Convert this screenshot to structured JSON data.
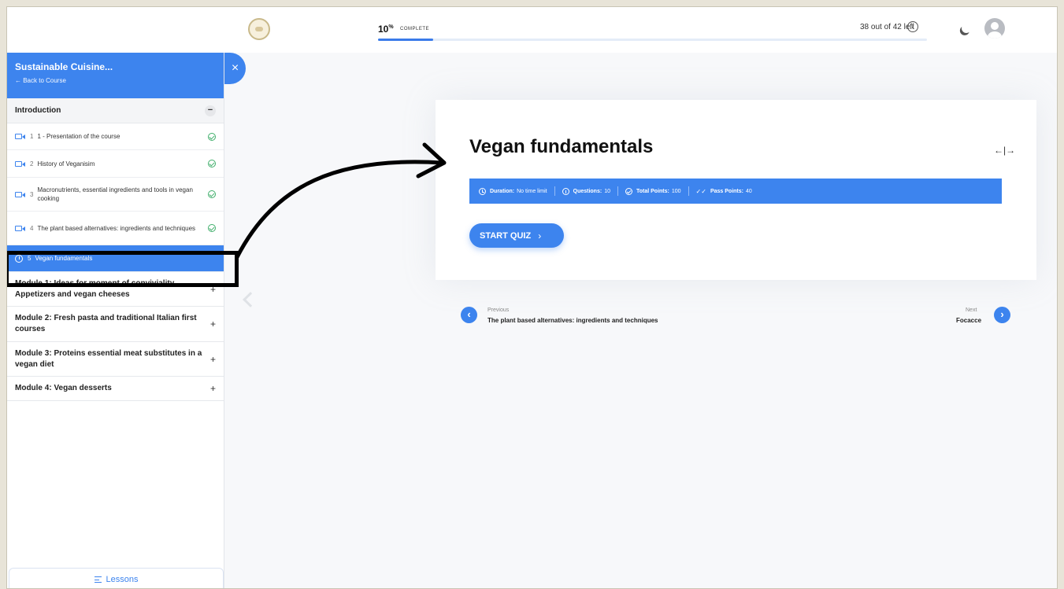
{
  "topbar": {
    "progress_percent": "10",
    "progress_symbol": "%",
    "progress_label": "COMPLETE",
    "progress_fraction": 0.1,
    "lessons_left": "38 out of 42 left",
    "info_icon": "info-icon",
    "theme_icon": "moon-icon",
    "avatar_icon": "user-avatar"
  },
  "sidebar": {
    "course_title": "Sustainable Cuisine...",
    "back_link": "← Back to Course",
    "intro_section": {
      "title": "Introduction",
      "toggle": "−",
      "lessons": [
        {
          "number": "1",
          "title": "1 - Presentation of the course",
          "icon": "video-icon",
          "status": "completed"
        },
        {
          "number": "2",
          "title": "History of Veganisim",
          "icon": "video-icon",
          "status": "completed"
        },
        {
          "number": "3",
          "title": "Macronutrients, essential ingredients and tools in vegan cooking",
          "icon": "video-icon",
          "status": "completed"
        },
        {
          "number": "4",
          "title": "The plant based alternatives: ingredients and techniques",
          "icon": "video-icon",
          "status": "completed"
        },
        {
          "number": "5",
          "title": "Vegan fundamentals",
          "icon": "timer-icon",
          "status": "active"
        }
      ]
    },
    "modules": [
      {
        "title": "Module 1: Ideas for moment of conviviality. Appetizers and vegan cheeses",
        "toggle": "+"
      },
      {
        "title": "Module 2: Fresh pasta and traditional Italian first courses",
        "toggle": "+"
      },
      {
        "title": "Module 3: Proteins essential meat substitutes in a vegan diet",
        "toggle": "+"
      },
      {
        "title": "Module 4: Vegan desserts",
        "toggle": "+"
      }
    ],
    "close_label": "×",
    "lessons_button": "Lessons"
  },
  "quiz": {
    "title": "Vegan fundamentals",
    "expand_icon": "←|→",
    "duration_label": "Duration:",
    "duration_value": "No time limit",
    "questions_label": "Questions:",
    "questions_value": "10",
    "total_points_label": "Total Points:",
    "total_points_value": "100",
    "pass_points_label": "Pass Points:",
    "pass_points_value": "40",
    "start_button": "START QUIZ",
    "start_chevron": "›"
  },
  "navigation": {
    "previous_label": "Previous",
    "previous_title": "The plant based alternatives: ingredients and techniques",
    "previous_icon": "‹",
    "next_label": "Next",
    "next_title": "Focacce",
    "next_icon": "›"
  },
  "colors": {
    "accent": "#3d84ee",
    "success": "#3fae6a",
    "background": "#f7f8fa",
    "outer_border": "#e8e4d8"
  }
}
